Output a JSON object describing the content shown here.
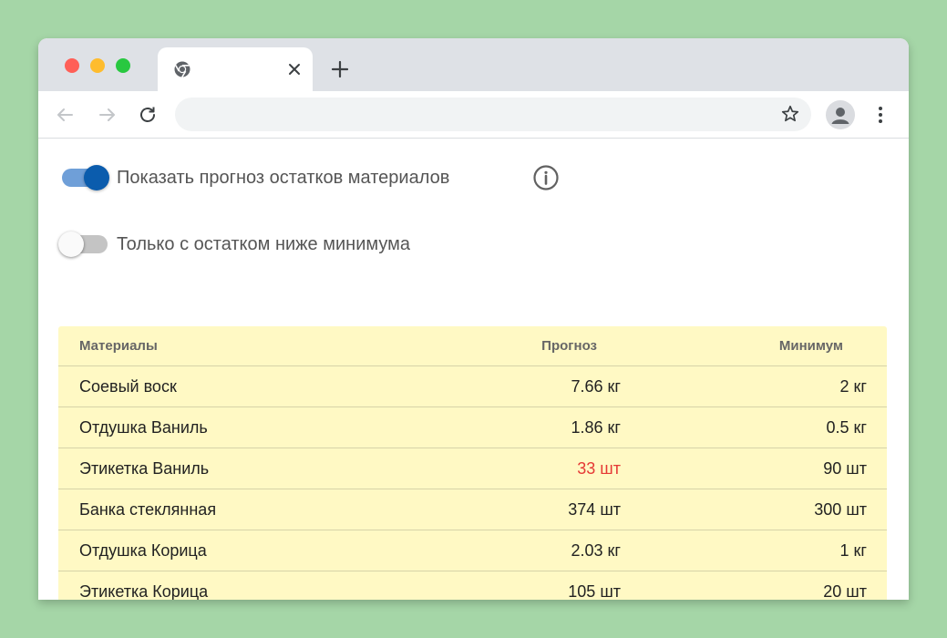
{
  "colors": {
    "background": "#a5d6a7",
    "close_dot": "#ff5f57",
    "minimize_dot": "#febc2e",
    "maximize_dot": "#28c840",
    "toggle_on": "#0b5cad",
    "table_bg": "#fff9c4",
    "warning_text": "#e53935"
  },
  "browser": {
    "tab": {
      "icon": "chrome-icon",
      "close_icon": "close-icon"
    },
    "new_tab_icon": "plus-icon",
    "toolbar": {
      "back_icon": "arrow-left-icon",
      "forward_icon": "arrow-right-icon",
      "reload_icon": "reload-icon",
      "address_value": "",
      "bookmark_icon": "star-icon",
      "profile_icon": "person-icon",
      "menu_icon": "kebab-menu-icon"
    }
  },
  "filters": {
    "show_forecast": {
      "label": "Показать прогноз остатков материалов",
      "checked": true
    },
    "below_minimum": {
      "label": "Только с остатком ниже минимума",
      "checked": false
    },
    "info_icon": "info-icon"
  },
  "table": {
    "headers": [
      "Материалы",
      "Прогноз",
      "Минимум"
    ],
    "rows": [
      {
        "material": "Соевый воск",
        "forecast": "7.66 кг",
        "minimum": "2 кг",
        "below_minimum": false
      },
      {
        "material": "Отдушка Ваниль",
        "forecast": "1.86 кг",
        "minimum": "0.5 кг",
        "below_minimum": false
      },
      {
        "material": "Этикетка Ваниль",
        "forecast": "33 шт",
        "minimum": "90 шт",
        "below_minimum": true
      },
      {
        "material": "Банка стеклянная",
        "forecast": "374 шт",
        "minimum": "300 шт",
        "below_minimum": false
      },
      {
        "material": "Отдушка Корица",
        "forecast": "2.03 кг",
        "minimum": "1 кг",
        "below_minimum": false
      },
      {
        "material": "Этикетка Корица",
        "forecast": "105 шт",
        "minimum": "20 шт",
        "below_minimum": false
      }
    ]
  }
}
